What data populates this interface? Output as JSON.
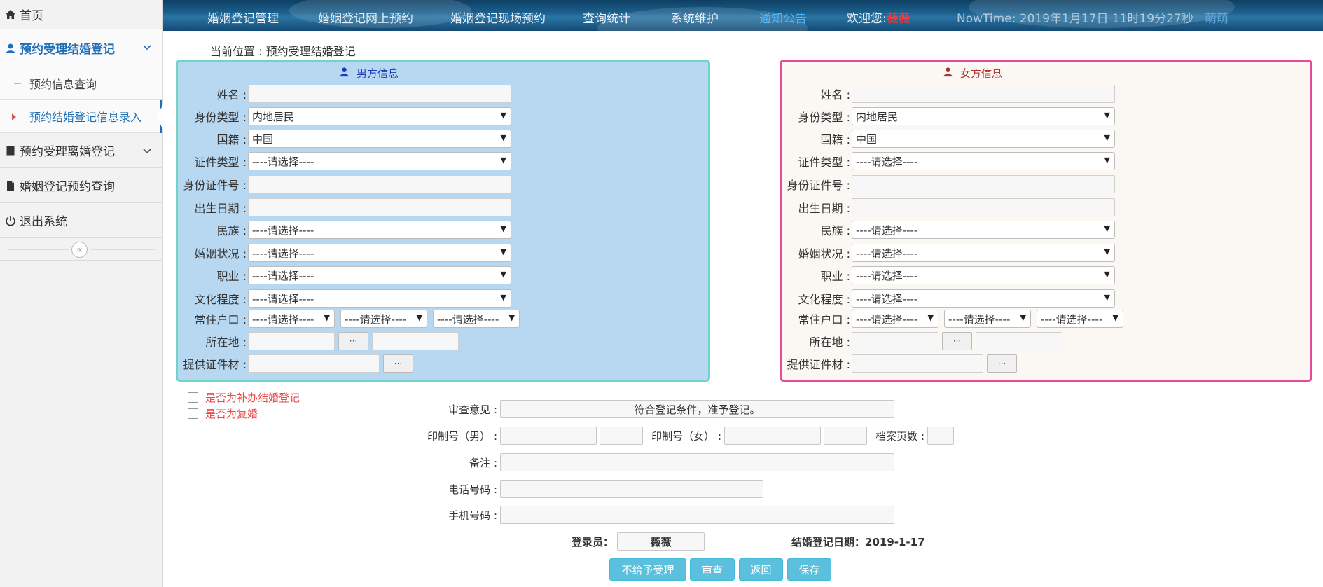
{
  "sidebar": {
    "home": "首页",
    "group_marriage": "预约受理结婚登记",
    "sub_query": "预约信息查询",
    "sub_entry": "预约结婚登记信息录入",
    "group_divorce": "预约受理离婚登记",
    "reservation_query": "婚姻登记预约查询",
    "logout": "退出系统"
  },
  "topnav": {
    "items": [
      "婚姻登记管理",
      "婚姻登记网上预约",
      "婚姻登记现场预约",
      "查询统计",
      "系统维护",
      "通知公告"
    ],
    "welcome_label": "欢迎您:",
    "welcome_name": "薇薇",
    "nowtime": "NowTime: 2019年1月17日 11时19分27秒",
    "meng": "萌萌"
  },
  "breadcrumb": "当前位置 : 预约受理结婚登记",
  "male": {
    "title": "男方信息",
    "labels": {
      "name": "姓名 :",
      "id_type": "身份类型 :",
      "nationality": "国籍 :",
      "cert_type": "证件类型 :",
      "id_number": "身份证件号 :",
      "birth": "出生日期 :",
      "ethnicity": "民族 :",
      "marital": "婚姻状况 :",
      "occupation": "职业 :",
      "education": "文化程度 :",
      "hukou": "常住户口 :",
      "location": "所在地 :",
      "materials": "提供证件材 :"
    },
    "values": {
      "id_type": "内地居民",
      "nationality": "中国",
      "cert_type": "----请选择----",
      "ethnicity": "----请选择----",
      "marital": "----请选择----",
      "occupation": "----请选择----",
      "education": "----请选择----",
      "hukou1": "----请选择----",
      "hukou2": "----请选择----",
      "hukou3": "----请选择----"
    }
  },
  "female": {
    "title": "女方信息",
    "labels": {
      "name": "姓名 :",
      "id_type": "身份类型 :",
      "nationality": "国籍 :",
      "cert_type": "证件类型 :",
      "id_number": "身份证件号 :",
      "birth": "出生日期 :",
      "ethnicity": "民族 :",
      "marital": "婚姻状况 :",
      "occupation": "职业 :",
      "education": "文化程度 :",
      "hukou": "常住户口 :",
      "location": "所在地 :",
      "materials": "提供证件材 :"
    },
    "values": {
      "id_type": "内地居民",
      "nationality": "中国",
      "cert_type": "----请选择----",
      "ethnicity": "----请选择----",
      "marital": "----请选择----",
      "occupation": "----请选择----",
      "education": "----请选择----",
      "hukou1": "----请选择----",
      "hukou2": "----请选择----",
      "hukou3": "----请选择----"
    }
  },
  "ellipsis": "···",
  "checkboxes": {
    "supplement": "是否为补办结婚登记",
    "remarry": "是否为复婚"
  },
  "form": {
    "review_label": "审查意见 :",
    "review_value": "符合登记条件，准予登记。",
    "print_male_label": "印制号（男） :",
    "print_female_label": "印制号（女） :",
    "archive_pages_label": "档案页数 :",
    "remark_label": "备注 :",
    "phone_label": "电话号码 :",
    "mobile_label": "手机号码 :",
    "recorder_label": "登录员：",
    "recorder_value": "薇薇",
    "date_label": "结婚登记日期：2019-1-17"
  },
  "buttons": {
    "reject": "不给予受理",
    "review": "审查",
    "back": "返回",
    "save": "保存"
  },
  "colors": {
    "accent": "#1f6eb8",
    "male_panel_bg": "#b8d8f2",
    "male_panel_border": "#6fd5c8",
    "female_panel_border": "#e84a9a",
    "button": "#5bc0de",
    "warning_text": "#e84a4a"
  }
}
